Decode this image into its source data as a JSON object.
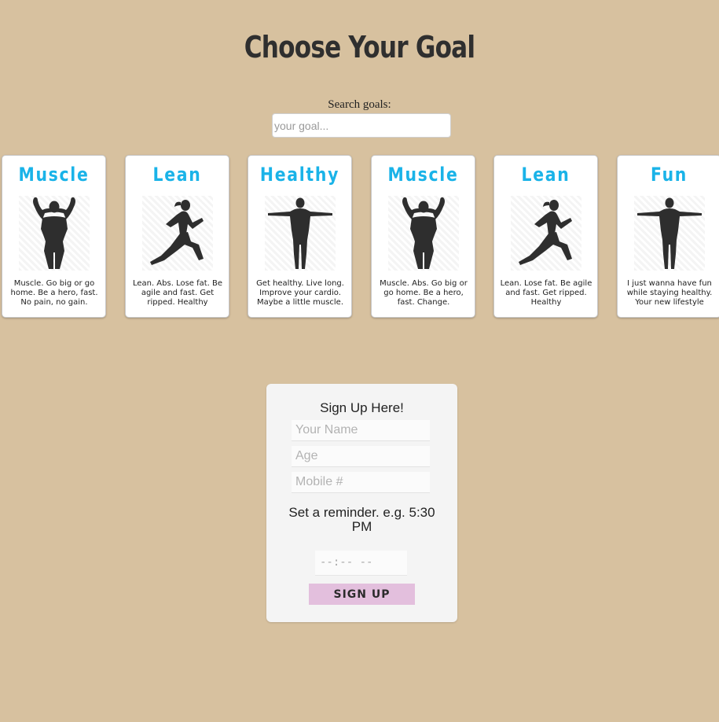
{
  "header": {
    "title": "Choose Your Goal"
  },
  "search": {
    "label": "Search goals:",
    "placeholder": "your goal...",
    "value": ""
  },
  "cards": [
    {
      "title": "Muscle",
      "icon": "muscle-figure-icon",
      "description": "Muscle. Go big or go home. Be a hero, fast. No pain, no gain."
    },
    {
      "title": "Lean",
      "icon": "runner-figure-icon",
      "description": "Lean. Abs. Lose fat. Be agile and fast. Get ripped. Healthy"
    },
    {
      "title": "Healthy",
      "icon": "standing-figure-icon",
      "description": "Get healthy. Live long. Improve your cardio. Maybe a little muscle."
    },
    {
      "title": "Muscle",
      "icon": "muscle-figure-icon",
      "description": "Muscle. Abs. Go big or go home. Be a hero, fast. Change."
    },
    {
      "title": "Lean",
      "icon": "runner-figure-icon",
      "description": "Lean. Lose fat. Be agile and fast. Get ripped. Healthy"
    },
    {
      "title": "Fun",
      "icon": "standing-figure-icon",
      "description": "I just wanna have fun while staying healthy. Your new lifestyle"
    }
  ],
  "signup": {
    "title": "Sign Up Here!",
    "name_placeholder": "Your Name",
    "age_placeholder": "Age",
    "mobile_placeholder": "Mobile #",
    "reminder_label": "Set a reminder. e.g. 5:30 PM",
    "time_placeholder": "--:-- --",
    "button_label": "SIGN UP"
  },
  "colors": {
    "background": "#d7c19f",
    "card_title": "#1ab3e8",
    "button": "#e3bfdd"
  }
}
